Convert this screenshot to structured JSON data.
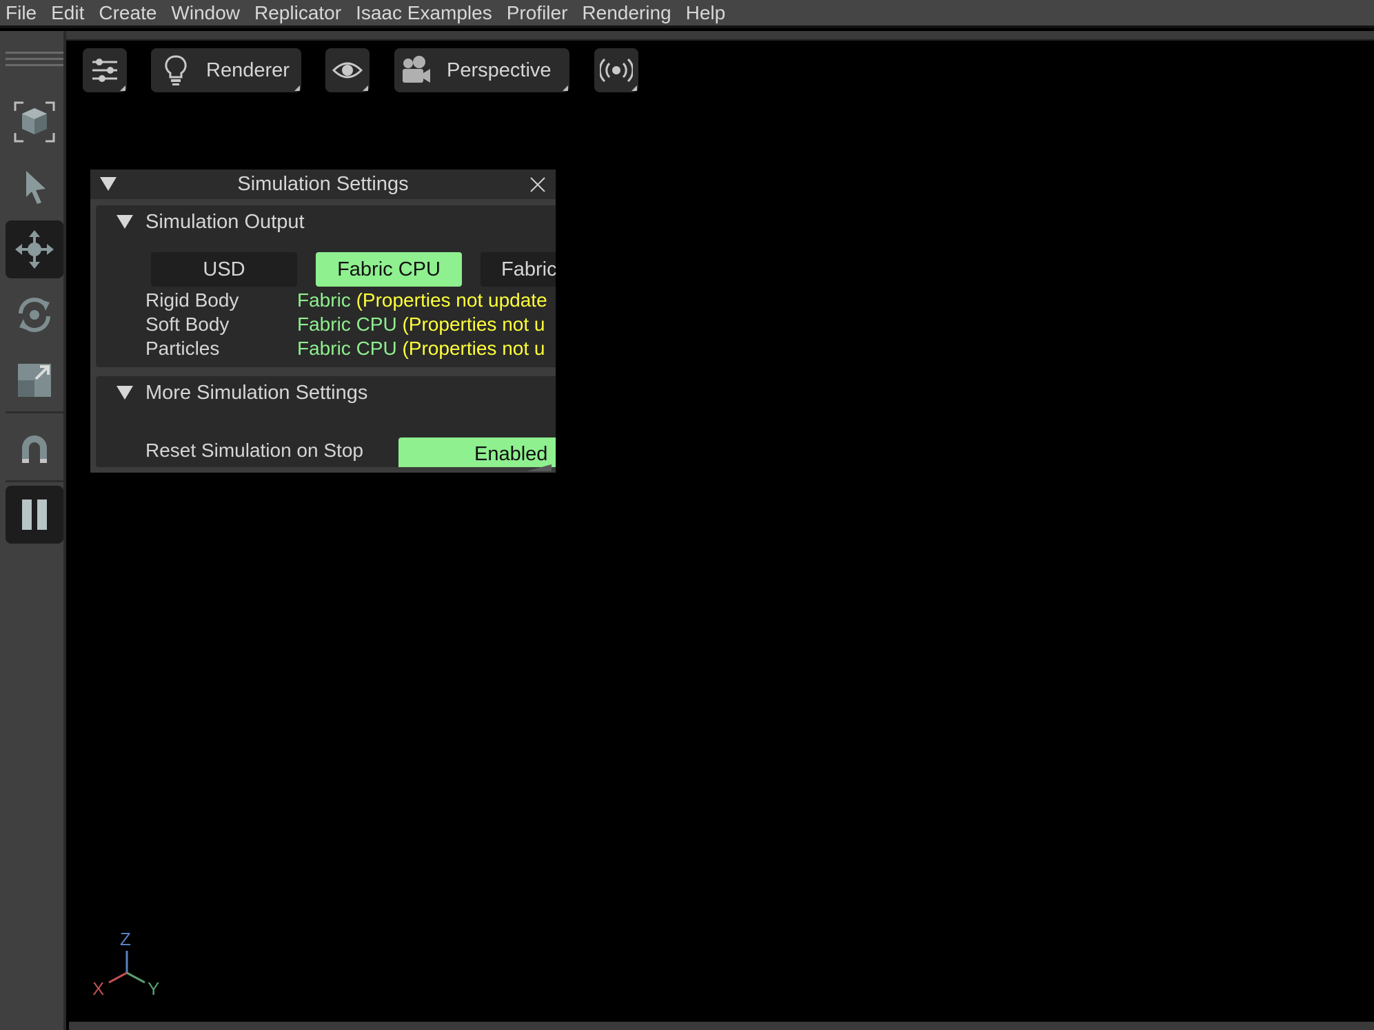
{
  "menubar": {
    "items": [
      "File",
      "Edit",
      "Create",
      "Window",
      "Replicator",
      "Isaac Examples",
      "Profiler",
      "Rendering",
      "Help"
    ]
  },
  "left_toolbar": {
    "tools": [
      {
        "name": "frame-selection",
        "icon": "cube-frame-icon"
      },
      {
        "name": "select",
        "icon": "cursor-arrow-icon"
      },
      {
        "name": "move",
        "icon": "move-arrows-icon",
        "active": true
      },
      {
        "name": "rotate",
        "icon": "rotate-icon"
      },
      {
        "name": "scale",
        "icon": "scale-icon"
      },
      {
        "name": "snap",
        "icon": "magnet-icon"
      },
      {
        "name": "pause",
        "icon": "pause-icon",
        "active": true
      }
    ]
  },
  "viewport_toolbar": {
    "settings_icon": "sliders-icon",
    "renderer_label": "Renderer",
    "renderer_icon": "lightbulb-icon",
    "visibility_icon": "eye-icon",
    "camera_label": "Perspective",
    "camera_icon": "camera-icon",
    "stream_icon": "broadcast-icon"
  },
  "simulation_settings": {
    "title": "Simulation Settings",
    "output_section": {
      "header": "Simulation Output",
      "options": [
        "USD",
        "Fabric CPU",
        "Fabric"
      ],
      "selected": "Fabric CPU",
      "rows": [
        {
          "label": "Rigid Body",
          "value": "Fabric",
          "note": "(Properties not update"
        },
        {
          "label": "Soft Body",
          "value": "Fabric CPU",
          "note": "(Properties not u"
        },
        {
          "label": "Particles",
          "value": "Fabric CPU",
          "note": "(Properties not u"
        }
      ]
    },
    "more_section": {
      "header": "More Simulation Settings",
      "reset_label": "Reset Simulation on Stop",
      "reset_value": "Enabled"
    }
  },
  "axis_gizmo": {
    "x": "X",
    "y": "Y",
    "z": "Z"
  },
  "colors": {
    "accent_green": "#8ef08e",
    "warning_yellow": "#ffff3a",
    "axis_x": "#c05050",
    "axis_y": "#5aa070",
    "axis_z": "#5a80c0"
  }
}
